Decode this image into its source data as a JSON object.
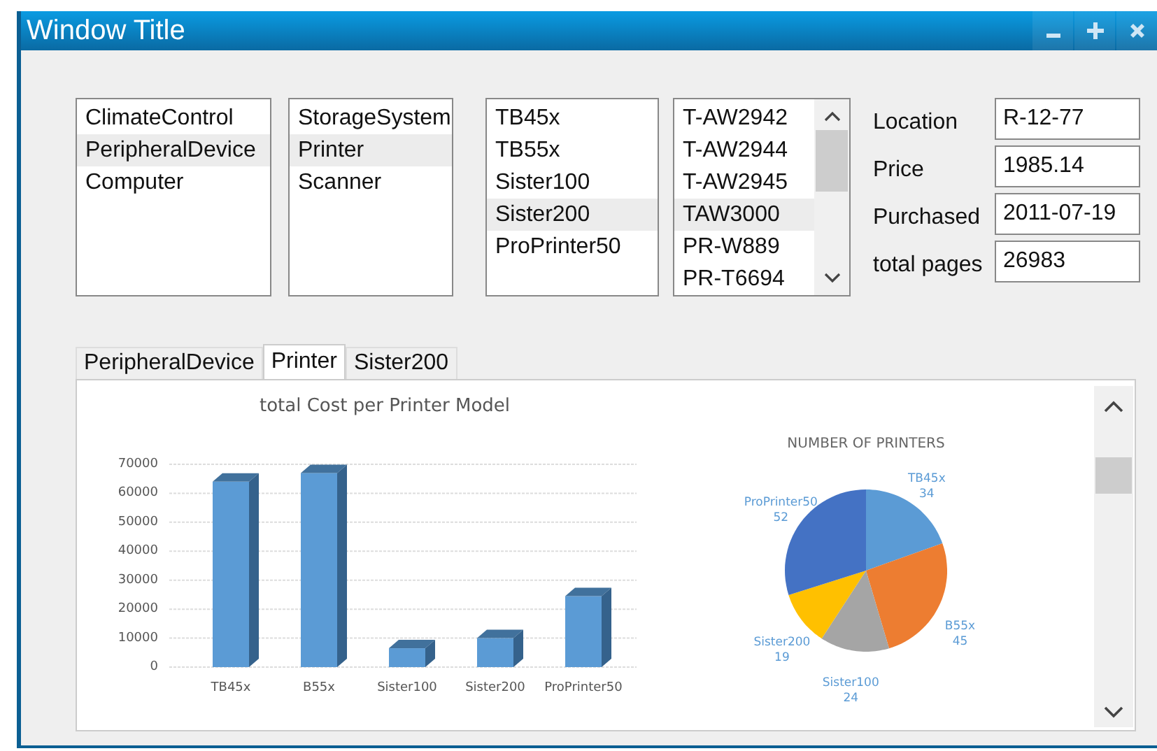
{
  "window": {
    "title": "Window Title"
  },
  "lists": [
    {
      "items": [
        {
          "label": "ClimateControl",
          "selected": false
        },
        {
          "label": "PeripheralDevice",
          "selected": true
        },
        {
          "label": "Computer",
          "selected": false
        }
      ]
    },
    {
      "items": [
        {
          "label": "StorageSystem",
          "selected": false
        },
        {
          "label": "Printer",
          "selected": true
        },
        {
          "label": "Scanner",
          "selected": false
        }
      ]
    },
    {
      "items": [
        {
          "label": "TB45x",
          "selected": false
        },
        {
          "label": "TB55x",
          "selected": false
        },
        {
          "label": "Sister100",
          "selected": false
        },
        {
          "label": "Sister200",
          "selected": true
        },
        {
          "label": "ProPrinter50",
          "selected": false
        }
      ]
    },
    {
      "items": [
        {
          "label": "T-AW2942",
          "selected": false
        },
        {
          "label": "T-AW2944",
          "selected": false
        },
        {
          "label": "T-AW2945",
          "selected": false
        },
        {
          "label": "TAW3000",
          "selected": true
        },
        {
          "label": "PR-W889",
          "selected": false
        },
        {
          "label": "PR-T6694",
          "selected": false
        }
      ]
    }
  ],
  "details": [
    {
      "label": "Location",
      "value": "R-12-77"
    },
    {
      "label": "Price",
      "value": "1985.14"
    },
    {
      "label": "Purchased",
      "value": "2011-07-19"
    },
    {
      "label": "total pages",
      "value": "26983"
    }
  ],
  "tabs": [
    {
      "label": "PeripheralDevice",
      "selected": false
    },
    {
      "label": "Printer",
      "selected": true
    },
    {
      "label": "Sister200",
      "selected": false
    }
  ],
  "charts": [
    {
      "chart_data": {
        "type": "bar",
        "title": "total Cost per Printer Model",
        "categories": [
          "TB45x",
          "B55x",
          "Sister100",
          "Sister200",
          "ProPrinter50"
        ],
        "values": [
          64000,
          67000,
          6500,
          10000,
          24500
        ],
        "grid": true,
        "ylim": [
          0,
          70000
        ],
        "yticks": [
          0,
          10000,
          20000,
          30000,
          40000,
          50000,
          60000,
          70000
        ]
      }
    },
    {
      "chart_data": {
        "type": "pie",
        "title": "NUMBER OF PRINTERS",
        "categories": [
          "TB45x",
          "B55x",
          "Sister100",
          "Sister200",
          "ProPrinter50"
        ],
        "series": [
          {
            "values": [
              34,
              45,
              24,
              19,
              52
            ]
          }
        ],
        "colors": [
          "#5b9bd5",
          "#ed7d31",
          "#a5a5a5",
          "#ffc000",
          "#4472c4"
        ],
        "data_labels": true
      }
    }
  ]
}
